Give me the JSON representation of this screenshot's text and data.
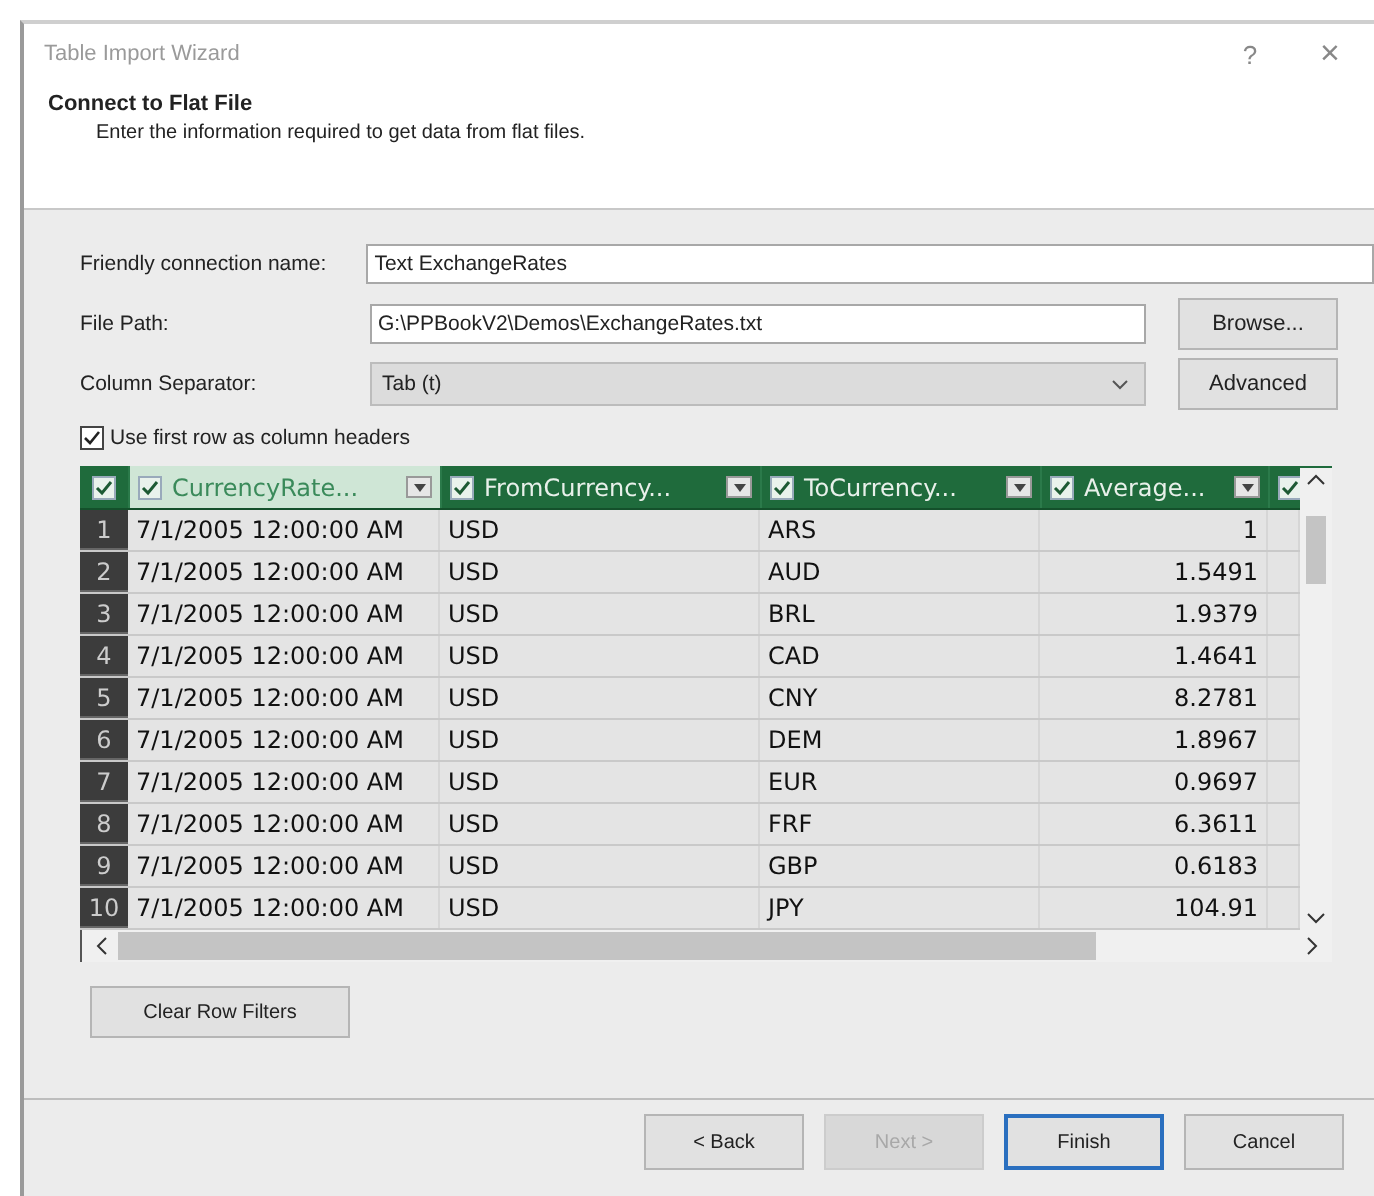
{
  "window": {
    "title": "Table Import Wizard",
    "help": "?",
    "close": "×"
  },
  "header": {
    "title": "Connect to Flat File",
    "subtitle": "Enter the information required to get data from flat files."
  },
  "form": {
    "name_label": "Friendly connection name:",
    "name_value": "Text ExchangeRates",
    "path_label": "File Path:",
    "path_value": "G:\\PPBookV2\\Demos\\ExchangeRates.txt",
    "browse": "Browse...",
    "separator_label": "Column Separator:",
    "separator_value": "Tab (t)",
    "advanced": "Advanced",
    "first_row": {
      "label": "Use first row as column headers",
      "checked": true
    }
  },
  "table": {
    "all_checked": true,
    "columns": [
      {
        "label": "CurrencyRate...",
        "checked": true,
        "selected": true
      },
      {
        "label": "FromCurrency...",
        "checked": true,
        "selected": false
      },
      {
        "label": "ToCurrency...",
        "checked": true,
        "selected": false
      },
      {
        "label": "Average...",
        "checked": true,
        "selected": false
      },
      {
        "checked": true,
        "selected": false
      }
    ],
    "rows": [
      {
        "num": "1",
        "cells": [
          "7/1/2005 12:00:00 AM",
          "USD",
          "ARS",
          "1"
        ]
      },
      {
        "num": "2",
        "cells": [
          "7/1/2005 12:00:00 AM",
          "USD",
          "AUD",
          "1.5491"
        ]
      },
      {
        "num": "3",
        "cells": [
          "7/1/2005 12:00:00 AM",
          "USD",
          "BRL",
          "1.9379"
        ]
      },
      {
        "num": "4",
        "cells": [
          "7/1/2005 12:00:00 AM",
          "USD",
          "CAD",
          "1.4641"
        ]
      },
      {
        "num": "5",
        "cells": [
          "7/1/2005 12:00:00 AM",
          "USD",
          "CNY",
          "8.2781"
        ]
      },
      {
        "num": "6",
        "cells": [
          "7/1/2005 12:00:00 AM",
          "USD",
          "DEM",
          "1.8967"
        ]
      },
      {
        "num": "7",
        "cells": [
          "7/1/2005 12:00:00 AM",
          "USD",
          "EUR",
          "0.9697"
        ]
      },
      {
        "num": "8",
        "cells": [
          "7/1/2005 12:00:00 AM",
          "USD",
          "FRF",
          "6.3611"
        ]
      },
      {
        "num": "9",
        "cells": [
          "7/1/2005 12:00:00 AM",
          "USD",
          "GBP",
          "0.6183"
        ]
      },
      {
        "num": "10",
        "cells": [
          "7/1/2005 12:00:00 AM",
          "USD",
          "JPY",
          "104.91"
        ]
      }
    ]
  },
  "clear_filters": "Clear Row Filters",
  "buttons": [
    {
      "label": "< Back",
      "disabled": false,
      "default": false
    },
    {
      "label": "Next >",
      "disabled": true,
      "default": false
    },
    {
      "label": "Finish",
      "disabled": false,
      "default": true
    },
    {
      "label": "Cancel",
      "disabled": false,
      "default": false
    }
  ]
}
